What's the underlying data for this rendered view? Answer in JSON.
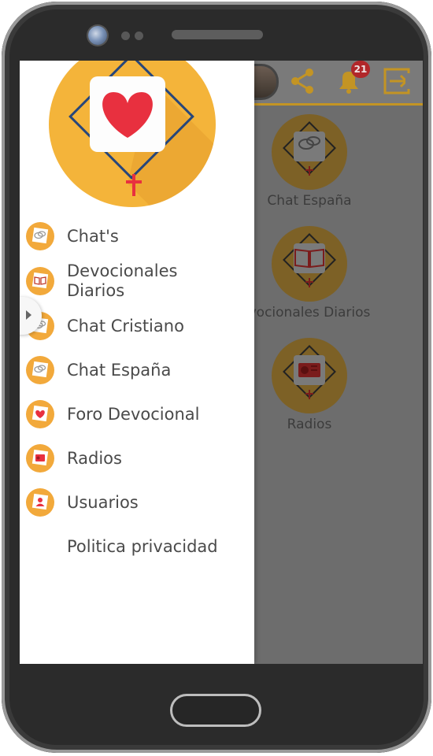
{
  "device": {
    "camera": "front-camera-icon",
    "speaker": "speaker-grille",
    "home": "home-button"
  },
  "appbar": {
    "icons": [
      "avatar-icon",
      "share-icon",
      "bell-icon",
      "logout-icon"
    ],
    "notifications_count": "21"
  },
  "tiles": [
    {
      "label": "Chat España",
      "icon": "chat-icon"
    },
    {
      "label": "vocionales Diarios",
      "icon": "book-icon"
    },
    {
      "label": "Radios",
      "icon": "radio-icon"
    }
  ],
  "drawer": {
    "logo_icon": "heart-rosary-icon",
    "items": [
      {
        "label": "Chat's",
        "icon": "chat-icon"
      },
      {
        "label": "Devocionales",
        "label2": "Diarios",
        "icon": "book-icon"
      },
      {
        "label": "Chat Cristiano",
        "icon": "chat-icon"
      },
      {
        "label": "Chat España",
        "icon": "chat-icon"
      },
      {
        "label": "Foro Devocional",
        "icon": "heart-icon"
      },
      {
        "label": "Radios",
        "icon": "radio-icon"
      },
      {
        "label": "Usuarios",
        "icon": "users-icon"
      },
      {
        "label": "Politica privacidad"
      }
    ]
  },
  "colors": {
    "accent": "#f4b43a",
    "heart": "#e8303f",
    "badge": "#b1272a",
    "dim_overlay": "#6d6d6d"
  }
}
